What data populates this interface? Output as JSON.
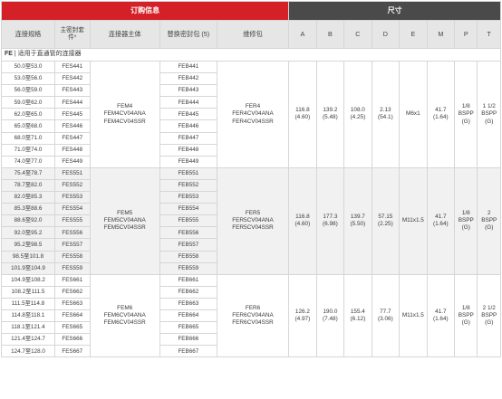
{
  "header": {
    "order_info": "订购信息",
    "dimensions": "尺寸"
  },
  "columns": {
    "spec": "连接规格",
    "seal_main": "主密封套",
    "seal_note": "件*",
    "body": "连接器主体",
    "replacement": "替换密封包 (5)",
    "repair": "维修包",
    "A": "A",
    "B": "B",
    "C": "C",
    "D": "D",
    "E": "E",
    "M": "M",
    "P": "P",
    "T": "T"
  },
  "section": {
    "code": "FE",
    "title": " | 适用于直通管的连接器"
  },
  "groups": [
    {
      "body_lines": [
        "FEM4",
        "FEM4CV04ANA",
        "FEM4CV04SSR"
      ],
      "repair_lines": [
        "FER4",
        "FER4CV04ANA",
        "FER4CV04SSR"
      ],
      "A": [
        "116.8",
        "(4.60)"
      ],
      "B": [
        "139.2",
        "(5.48)"
      ],
      "C": [
        "108.0",
        "(4.25)"
      ],
      "D": [
        "2.13",
        "(54.1)"
      ],
      "E": [
        "M6x1"
      ],
      "M": [
        "41.7",
        "(1.64)"
      ],
      "P": [
        "1/8",
        "BSPP",
        "(G)"
      ],
      "T": [
        "1 1/2",
        "BSPP",
        "(G)"
      ],
      "rows": [
        {
          "spec": "50.0至53.0",
          "seal": "FES441",
          "repl": "FEB441"
        },
        {
          "spec": "53.0至56.0",
          "seal": "FES442",
          "repl": "FEB442"
        },
        {
          "spec": "56.0至59.0",
          "seal": "FES443",
          "repl": "FEB443"
        },
        {
          "spec": "59.0至62.0",
          "seal": "FES444",
          "repl": "FEB444"
        },
        {
          "spec": "62.0至65.0",
          "seal": "FES445",
          "repl": "FEB445"
        },
        {
          "spec": "65.0至68.0",
          "seal": "FES446",
          "repl": "FEB446"
        },
        {
          "spec": "68.0至71.0",
          "seal": "FES447",
          "repl": "FEB447"
        },
        {
          "spec": "71.0至74.0",
          "seal": "FES448",
          "repl": "FEB448"
        },
        {
          "spec": "74.0至77.0",
          "seal": "FES449",
          "repl": "FEB449"
        }
      ]
    },
    {
      "body_lines": [
        "FEM5",
        "FEM5CV04ANA",
        "FEM5CV04SSR"
      ],
      "repair_lines": [
        "FER5",
        "FER5CV04ANA",
        "FER5CV04SSR"
      ],
      "A": [
        "116.8",
        "(4.60)"
      ],
      "B": [
        "177.3",
        "(6.98)"
      ],
      "C": [
        "139.7",
        "(5.50)"
      ],
      "D": [
        "57.15",
        "(2.25)"
      ],
      "E": [
        "M11x1.5"
      ],
      "M": [
        "41.7",
        "(1.64)"
      ],
      "P": [
        "1/8",
        "BSPP",
        "(G)"
      ],
      "T": [
        "2",
        "BSPP",
        "(G)"
      ],
      "rows": [
        {
          "spec": "75.4至78.7",
          "seal": "FES551",
          "repl": "FEB551"
        },
        {
          "spec": "78.7至82.0",
          "seal": "FES552",
          "repl": "FEB552"
        },
        {
          "spec": "82.0至85.3",
          "seal": "FES553",
          "repl": "FEB553"
        },
        {
          "spec": "85.3至88.6",
          "seal": "FES554",
          "repl": "FEB554"
        },
        {
          "spec": "88.6至92.0",
          "seal": "FES555",
          "repl": "FEB555"
        },
        {
          "spec": "92.0至95.2",
          "seal": "FES556",
          "repl": "FEB556"
        },
        {
          "spec": "95.2至98.5",
          "seal": "FES557",
          "repl": "FEB557"
        },
        {
          "spec": "98.5至101.8",
          "seal": "FES558",
          "repl": "FEB558"
        },
        {
          "spec": "101.9至104.9",
          "seal": "FES559",
          "repl": "FEB559"
        }
      ]
    },
    {
      "body_lines": [
        "FEM6",
        "FEM6CV04ANA",
        "FEM6CV04SSR"
      ],
      "repair_lines": [
        "FER6",
        "FER6CV04ANA",
        "FER6CV04SSR"
      ],
      "A": [
        "126.2",
        "(4.97)"
      ],
      "B": [
        "190.0",
        "(7.48)"
      ],
      "C": [
        "155.4",
        "(6.12)"
      ],
      "D": [
        "77.7",
        "(3.06)"
      ],
      "E": [
        "M11x1.5"
      ],
      "M": [
        "41.7",
        "(1.64)"
      ],
      "P": [
        "1/8",
        "BSPP",
        "(G)"
      ],
      "T": [
        "2 1/2",
        "BSPP",
        "(G)"
      ],
      "rows": [
        {
          "spec": "104.9至108.2",
          "seal": "FES661",
          "repl": "FEB661"
        },
        {
          "spec": "108.2至111.5",
          "seal": "FES662",
          "repl": "FEB662"
        },
        {
          "spec": "111.5至114.8",
          "seal": "FES663",
          "repl": "FEB663"
        },
        {
          "spec": "114.8至118.1",
          "seal": "FES664",
          "repl": "FEB664"
        },
        {
          "spec": "118.1至121.4",
          "seal": "FES665",
          "repl": "FEB665"
        },
        {
          "spec": "121.4至124.7",
          "seal": "FES666",
          "repl": "FEB666"
        },
        {
          "spec": "124.7至128.0",
          "seal": "FES667",
          "repl": "FEB667"
        }
      ]
    }
  ]
}
